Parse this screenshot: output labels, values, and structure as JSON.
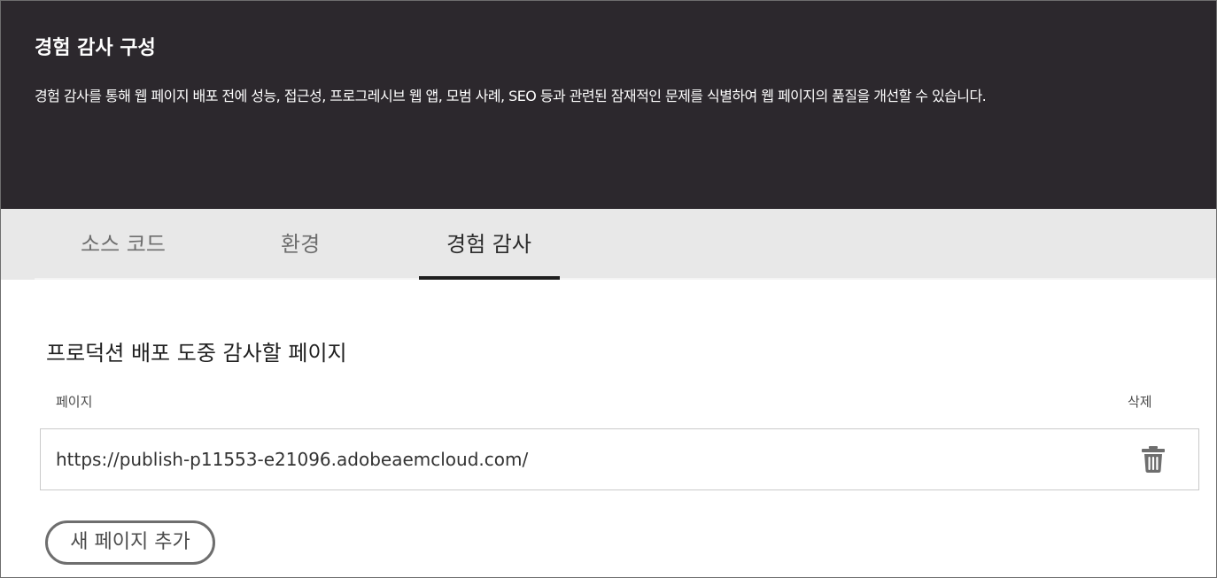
{
  "header": {
    "title": "경험 감사 구성",
    "description": "경험 감사를 통해 웹 페이지 배포 전에 성능, 접근성, 프로그레시브 웹 앱, 모범 사례, SEO 등과 관련된 잠재적인 문제를 식별하여 웹 페이지의 품질을 개선할 수 있습니다."
  },
  "tabs": [
    {
      "label": "소스 코드",
      "active": false
    },
    {
      "label": "환경",
      "active": false
    },
    {
      "label": "경험 감사",
      "active": true
    }
  ],
  "main": {
    "section_title": "프로덕션 배포 도중 감사할 페이지",
    "columns": {
      "page": "페이지",
      "delete": "삭제"
    },
    "pages": [
      {
        "url": "https://publish-p11553-e21096.adobeaemcloud.com/",
        "delete_icon": "trash-icon"
      }
    ],
    "add_button_label": "새 페이지 추가"
  },
  "colors": {
    "header_bg": "#2c282d",
    "tabbar_bg": "#e8e8e8",
    "active_tab_underline": "#1f1f1f"
  }
}
